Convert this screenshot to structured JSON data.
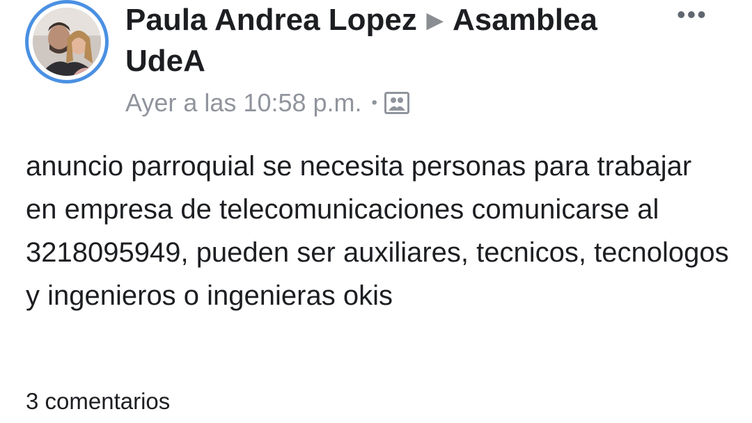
{
  "post": {
    "author": "Paula Andrea Lopez",
    "group": "Asamblea UdeA",
    "timestamp": "Ayer a las 10:58 p.m.",
    "separator": "•",
    "audience_icon": "group-photo-icon",
    "text": "anuncio parroquial se necesita personas para trabajar en empresa de telecomunicaciones comunicarse al 3218095949, pueden ser auxiliares, tecnicos, tecnologos y ingenieros o ingenieras okis",
    "comments_count_label": "3 comentarios"
  },
  "colors": {
    "avatar_ring": "#4a90e2",
    "text": "#1c1e21",
    "meta": "#90949c",
    "arrow": "#8a8d91"
  }
}
